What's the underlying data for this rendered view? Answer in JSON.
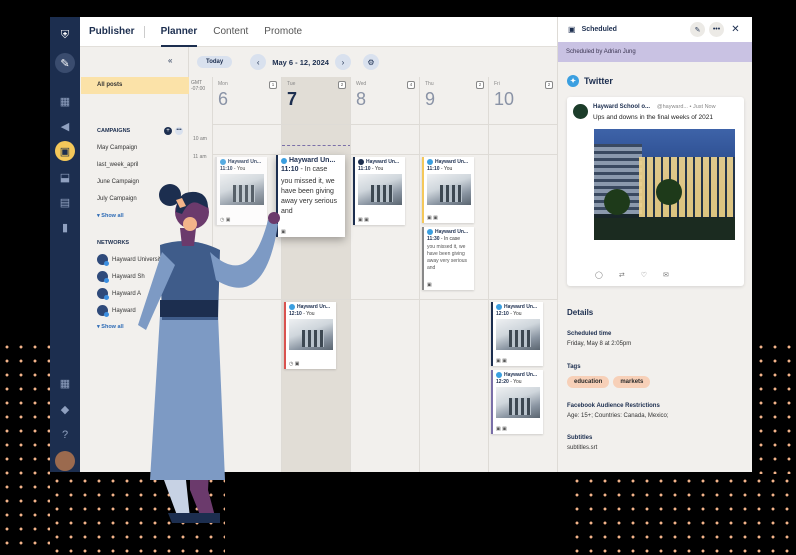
{
  "colors": {
    "rail": "#1c2e4f",
    "accent": "#f4c85a",
    "scheduled_banner": "#c9c2e3",
    "tag": "#f7d0b8",
    "twitter": "#3b9fe0",
    "dots": "#f3b48a"
  },
  "topbar": {
    "brand": "Publisher",
    "tabs": [
      "Planner",
      "Content",
      "Promote"
    ],
    "active_tab": "Planner"
  },
  "sidebar_icons": [
    "compose-icon",
    "dashboard-icon",
    "megaphone-icon",
    "calendar-icon",
    "inbox-icon",
    "clipboard-icon",
    "analytics-icon",
    "apps-icon",
    "bell-icon",
    "help-icon",
    "user-avatar"
  ],
  "left_panel": {
    "all_posts": "All posts",
    "campaigns_heading": "CAMPAIGNS",
    "campaigns": [
      "May Campaign",
      "last_week_april",
      "June Campaign",
      "July Campaign"
    ],
    "show_all": "Show all",
    "networks_heading": "NETWORKS",
    "networks": [
      "Hayward University",
      "Hayward Sh",
      "Hayward A",
      "Hayward"
    ],
    "show_all_2": "Show all"
  },
  "calendar": {
    "today_label": "Today",
    "range": "May 6 - 12, 2024",
    "gmt": "GMT\n-07:00",
    "time_labels": [
      "10 am",
      "11 am"
    ],
    "days": [
      {
        "name": "Mon",
        "num": "6",
        "badge": "1"
      },
      {
        "name": "Tue",
        "num": "7",
        "badge": "2"
      },
      {
        "name": "Wed",
        "num": "8",
        "badge": "4"
      },
      {
        "name": "Thu",
        "num": "9",
        "badge": "2"
      },
      {
        "name": "Fri",
        "num": "10",
        "badge": "2"
      }
    ],
    "posts": [
      {
        "title": "Hayward Un...",
        "time": "11:10",
        "by": "- You"
      },
      {
        "title": "Hayward Un...",
        "time": "11:10",
        "by": "- In case",
        "body": "you missed it, we have been giving away very serious and"
      },
      {
        "title": "Hayward Un...",
        "time": "11:10",
        "by": "- You"
      },
      {
        "title": "Hayward Un...",
        "time": "11:10",
        "by": "- You"
      },
      {
        "title": "Hayward Un...",
        "time": "11:30",
        "by": "- In case",
        "body": "you missed it, we have been giving away very serious and"
      },
      {
        "title": "Hayward Un...",
        "time": "12:10",
        "by": "- You"
      },
      {
        "title": "Hayward Un...",
        "time": "12:10",
        "by": "- You"
      },
      {
        "title": "Hayward Un...",
        "time": "12:20",
        "by": "- You"
      }
    ]
  },
  "detail": {
    "title": "Scheduled",
    "scheduled_by": "Scheduled by Adrian Jung",
    "network": "Twitter",
    "tweet": {
      "name": "Hayward School o...",
      "handle": "@hayward...",
      "when": "Just Now",
      "text": "Ups and downs in the final weeks of 2021"
    },
    "details_heading": "Details",
    "sched_time_label": "Scheduled time",
    "sched_time_value": "Friday, May 8 at 2:05pm",
    "tags_label": "Tags",
    "tags": [
      "education",
      "markets"
    ],
    "fb_label": "Facebook Audience Restrictions",
    "fb_value": "Age: 15+; Countries: Canada, Mexico;",
    "subtitles_label": "Subtitles",
    "subtitles_value": "subtitles.srt"
  }
}
